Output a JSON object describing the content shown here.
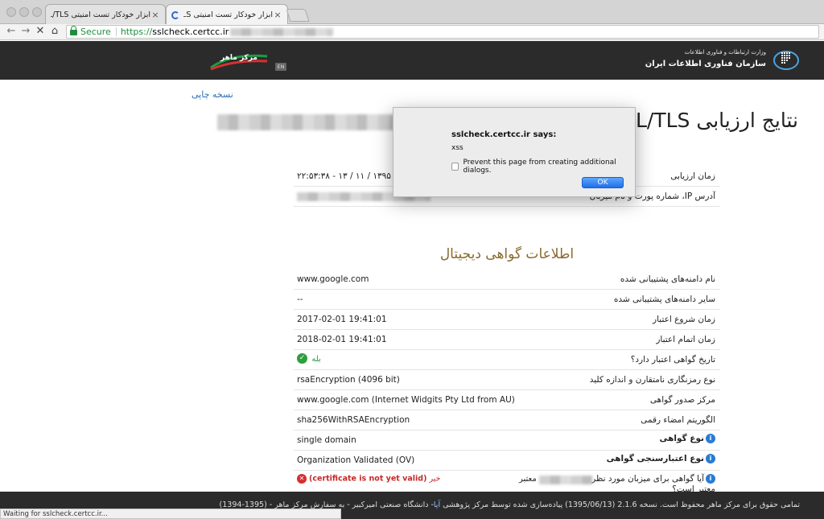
{
  "browser": {
    "tabs": [
      {
        "title": "ابزار خودکار تست امنیتی SSL/TLS",
        "active": false
      },
      {
        "title": "ابزار خودکار تست امنیتی SSL/TLS",
        "active": true
      }
    ],
    "close_glyph": "×",
    "secure_label": "Secure",
    "url_scheme": "https://",
    "url_host": "sslcheck.certcc.ir",
    "status_text": "Waiting for sslcheck.certcc.ir..."
  },
  "header": {
    "org_line1": "وزارت ارتباطات و فناوری اطلاعات",
    "org_line2": "سازمان فناوری اطلاعات ایران",
    "maher_label": "مرکز ماهر",
    "lang_button": "EN"
  },
  "content": {
    "print_link": "نسخه چاپی",
    "page_title": "نتایج ارزیابی SSL/TLS",
    "top_rows": [
      {
        "label": "زمان ارزیابی",
        "value": "۱۳۹۵ / ۱۱ / ۱۳ - ۲۲:۵۳:۳۸"
      },
      {
        "label": "آدرس IP، شماره پورت و نام میزبان",
        "value": ""
      }
    ],
    "section_title": "اطلاعات گواهی دیجیتال",
    "cert_rows": [
      {
        "label": "نام دامنه‌های پشتیبانی شده",
        "value": "www.google.com"
      },
      {
        "label": "سایر دامنه‌های پشتیبانی شده",
        "value": "--"
      },
      {
        "label": "زمان شروع اعتبار",
        "value": "2017-02-01 19:41:01"
      },
      {
        "label": "زمان اتمام اعتبار",
        "value": "2018-02-01 19:41:01"
      },
      {
        "label": "تاریخ گواهی اعتبار دارد؟",
        "value": "بله"
      },
      {
        "label": "نوع رمزنگاری نامتقارن و اندازه کلید",
        "value": "rsaEncryption (4096 bit)"
      },
      {
        "label": "مرکز صدور گواهی",
        "value": "www.google.com (Internet Widgits Pty Ltd from AU)"
      },
      {
        "label": "الگوریتم امضاء رقمی",
        "value": "sha256WithRSAEncryption"
      },
      {
        "label": "نوع گواهی",
        "value": "single domain"
      },
      {
        "label": "نوع اعتبارسنجی گواهی",
        "value": "Organization Validated (OV)"
      },
      {
        "label": "آیا گواهی برای میزبان مورد نظر معتبر است؟",
        "value": "خیر",
        "note": "(certificate is not yet valid)"
      }
    ],
    "valid_word": "معتبر"
  },
  "footer": {
    "text_before": "تمامی حقوق برای مرکز ماهر محفوظ است. نسخه 2.1.6 (1395/06/13)      پیاده‌سازی شده توسط مرکز پژوهشی ",
    "aut": "آپا",
    "text_after": "- دانشگاه صنعتی امیرکبیر - به سفارش مرکز ماهر - (1395-1394)"
  },
  "dialog": {
    "title": "sslcheck.certcc.ir says:",
    "message": "xss",
    "checkbox_label": "Prevent this page from creating additional dialogs.",
    "ok_label": "OK"
  },
  "icons": {
    "check": "✓",
    "cross": "✕",
    "info": "i",
    "back": "←",
    "forward": "→",
    "stop": "✕",
    "home": "⌂"
  },
  "colors": {
    "accent_gold": "#8a6a2e",
    "link_blue": "#2a6bb5",
    "secure_green": "#1e8e3e",
    "error_red": "#c62828",
    "header_dark": "#2b2b2b"
  }
}
